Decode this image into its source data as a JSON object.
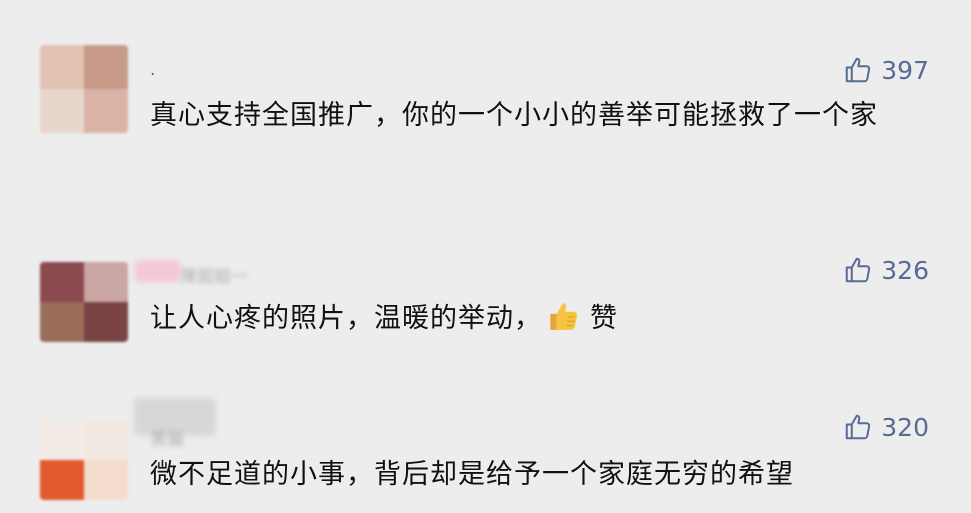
{
  "comments": [
    {
      "username": ".",
      "text": "真心支持全国推广，你的一个小小的善举可能拯救了一个家",
      "likes": "397",
      "avatar_colors": [
        "#e2c2b2",
        "#c79a8a",
        "#e8d6cc",
        "#dab3a6"
      ]
    },
    {
      "username": "陳姐姐一",
      "text_before": "让人心疼的照片，温暖的举动，",
      "emoji": "thumbs-up-emoji",
      "text_after": "赞",
      "likes": "326",
      "avatar_colors": [
        "#8a4a4e",
        "#caa6a4",
        "#9a6d58",
        "#7a4444"
      ]
    },
    {
      "username": "黑猫",
      "text": "微不足道的小事，背后却是给予一个家庭无穷的希望",
      "likes": "320",
      "avatar_colors": [
        "#f3ece6",
        "#f1e8e2",
        "#e15a2c",
        "#f4dccd"
      ]
    }
  ],
  "icons": {
    "like_icon": "thumbs-up-outline-icon",
    "emoji": "thumbs-up-emoji"
  },
  "colors": {
    "background": "#ededed",
    "like_color": "#576b95",
    "text_color": "#111111"
  }
}
